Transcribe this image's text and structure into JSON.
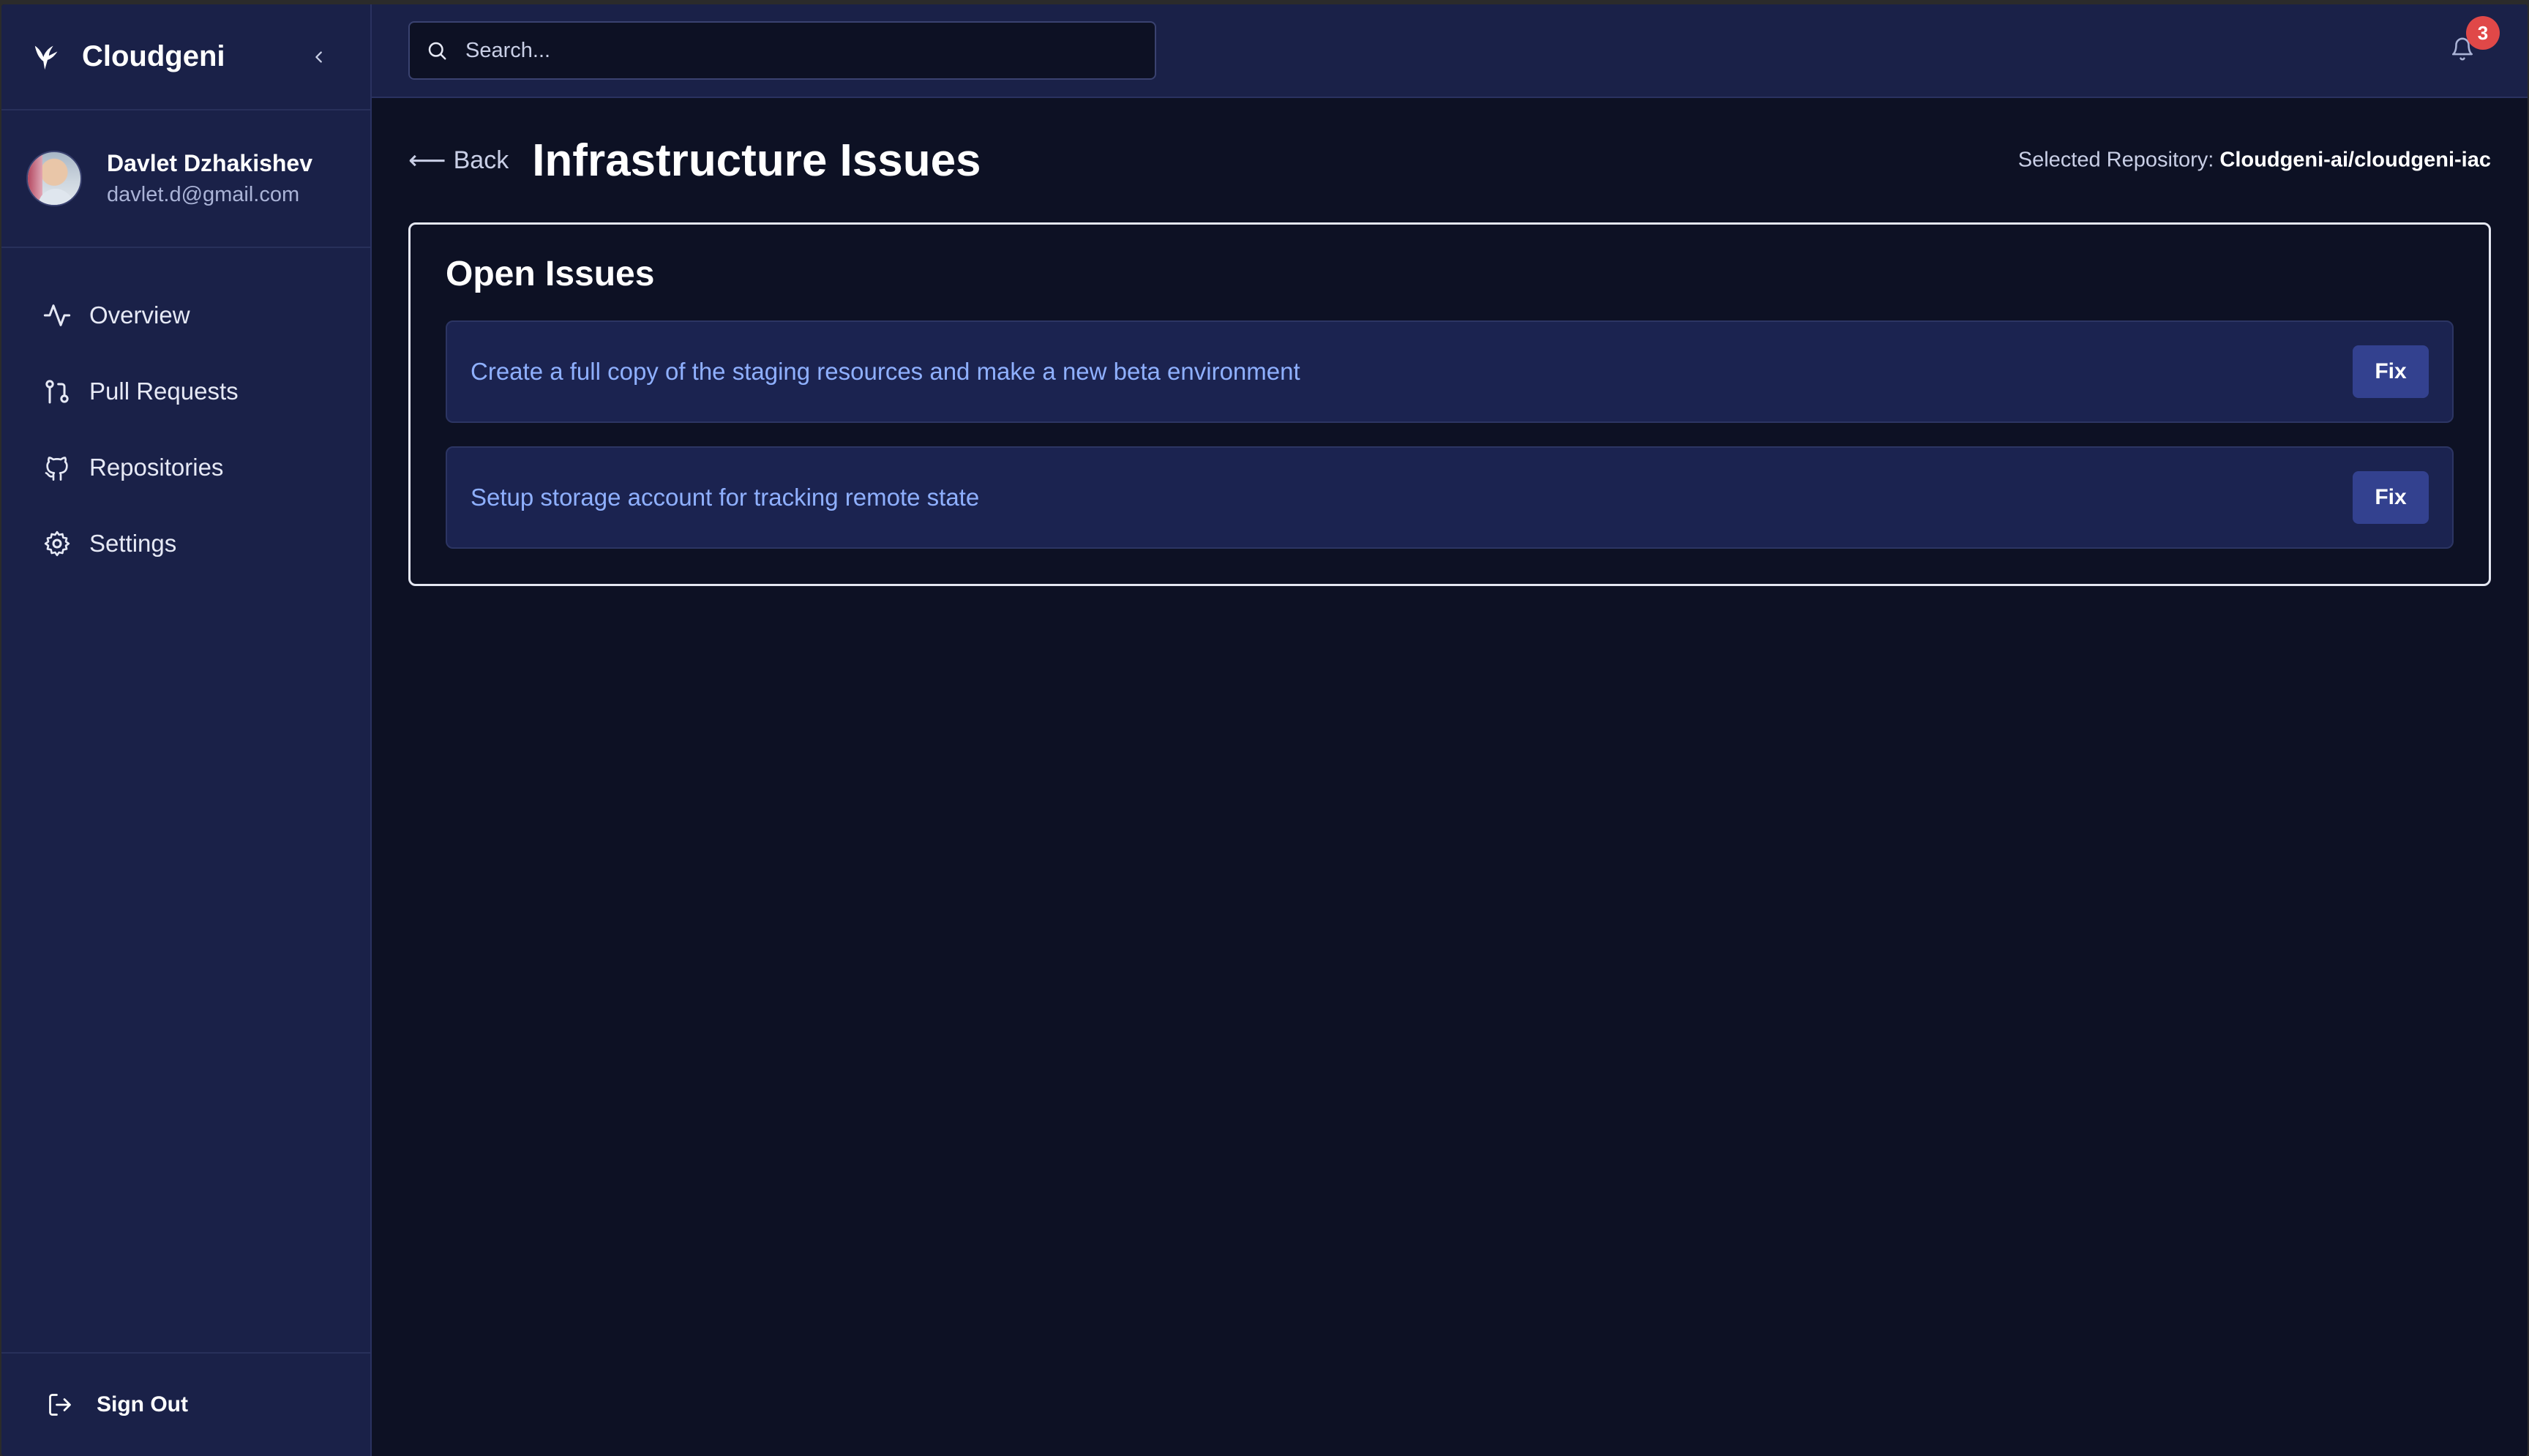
{
  "brand": {
    "name": "Cloudgeni"
  },
  "user": {
    "name": "Davlet Dzhakishev",
    "email": "davlet.d@gmail.com"
  },
  "sidebar": {
    "items": [
      {
        "label": "Overview",
        "icon": "activity-icon"
      },
      {
        "label": "Pull Requests",
        "icon": "git-pull-request-icon"
      },
      {
        "label": "Repositories",
        "icon": "github-icon"
      },
      {
        "label": "Settings",
        "icon": "gear-icon"
      }
    ],
    "sign_out_label": "Sign Out"
  },
  "topbar": {
    "search_placeholder": "Search...",
    "notification_count": "3"
  },
  "page": {
    "back_label": "Back",
    "title": "Infrastructure Issues",
    "repo_prefix": "Selected Repository:",
    "repo_name": "Cloudgeni-ai/cloudgeni-iac"
  },
  "issues": {
    "title": "Open Issues",
    "items": [
      {
        "text": "Create a full copy of the staging resources and make a new beta environment",
        "action": "Fix"
      },
      {
        "text": "Setup storage account for tracking remote state",
        "action": "Fix"
      }
    ]
  },
  "colors": {
    "background": "#0d1124",
    "sidebar": "#1a2148",
    "issue_link": "#8fb0ff",
    "fix_button": "#33418f",
    "badge": "#e04848"
  }
}
